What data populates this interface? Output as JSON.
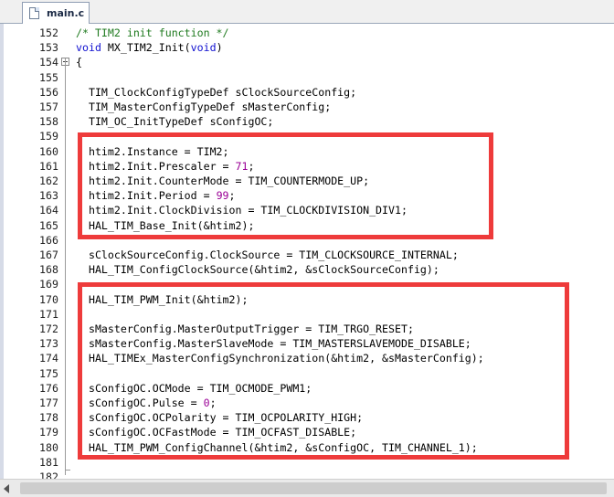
{
  "tab": {
    "label": "main.c",
    "icon": "c-file-icon"
  },
  "lines": [
    {
      "n": "152",
      "code": [
        {
          "t": "/* TIM2 init function */",
          "c": "comment"
        }
      ]
    },
    {
      "n": "153",
      "code": [
        {
          "t": "void",
          "c": "kw"
        },
        {
          "t": " MX_TIM2_Init("
        },
        {
          "t": "void",
          "c": "kw"
        },
        {
          "t": ")"
        }
      ]
    },
    {
      "n": "154",
      "code": [
        {
          "t": "{"
        }
      ],
      "fold": true
    },
    {
      "n": "155",
      "code": []
    },
    {
      "n": "156",
      "code": [
        {
          "t": "  TIM_ClockConfigTypeDef sClockSourceConfig;"
        }
      ]
    },
    {
      "n": "157",
      "code": [
        {
          "t": "  TIM_MasterConfigTypeDef sMasterConfig;"
        }
      ]
    },
    {
      "n": "158",
      "code": [
        {
          "t": "  TIM_OC_InitTypeDef sConfigOC;"
        }
      ]
    },
    {
      "n": "159",
      "code": []
    },
    {
      "n": "160",
      "code": [
        {
          "t": "  htim2.Instance = TIM2;"
        }
      ]
    },
    {
      "n": "161",
      "code": [
        {
          "t": "  htim2.Init.Prescaler = "
        },
        {
          "t": "71",
          "c": "num"
        },
        {
          "t": ";"
        }
      ]
    },
    {
      "n": "162",
      "code": [
        {
          "t": "  htim2.Init.CounterMode = TIM_COUNTERMODE_UP;"
        }
      ]
    },
    {
      "n": "163",
      "code": [
        {
          "t": "  htim2.Init.Period = "
        },
        {
          "t": "99",
          "c": "num"
        },
        {
          "t": ";"
        }
      ]
    },
    {
      "n": "164",
      "code": [
        {
          "t": "  htim2.Init.ClockDivision = TIM_CLOCKDIVISION_DIV1;"
        }
      ]
    },
    {
      "n": "165",
      "code": [
        {
          "t": "  HAL_TIM_Base_Init(&htim2);"
        }
      ]
    },
    {
      "n": "166",
      "code": []
    },
    {
      "n": "167",
      "code": [
        {
          "t": "  sClockSourceConfig.ClockSource = TIM_CLOCKSOURCE_INTERNAL;"
        }
      ]
    },
    {
      "n": "168",
      "code": [
        {
          "t": "  HAL_TIM_ConfigClockSource(&htim2, &sClockSourceConfig);"
        }
      ]
    },
    {
      "n": "169",
      "code": []
    },
    {
      "n": "170",
      "code": [
        {
          "t": "  HAL_TIM_PWM_Init(&htim2);"
        }
      ]
    },
    {
      "n": "171",
      "code": []
    },
    {
      "n": "172",
      "code": [
        {
          "t": "  sMasterConfig.MasterOutputTrigger = TIM_TRGO_RESET;"
        }
      ]
    },
    {
      "n": "173",
      "code": [
        {
          "t": "  sMasterConfig.MasterSlaveMode = TIM_MASTERSLAVEMODE_DISABLE;"
        }
      ]
    },
    {
      "n": "174",
      "code": [
        {
          "t": "  HAL_TIMEx_MasterConfigSynchronization(&htim2, &sMasterConfig);"
        }
      ]
    },
    {
      "n": "175",
      "code": []
    },
    {
      "n": "176",
      "code": [
        {
          "t": "  sConfigOC.OCMode = TIM_OCMODE_PWM1;"
        }
      ]
    },
    {
      "n": "177",
      "code": [
        {
          "t": "  sConfigOC.Pulse = "
        },
        {
          "t": "0",
          "c": "num"
        },
        {
          "t": ";"
        }
      ]
    },
    {
      "n": "178",
      "code": [
        {
          "t": "  sConfigOC.OCPolarity = TIM_OCPOLARITY_HIGH;"
        }
      ]
    },
    {
      "n": "179",
      "code": [
        {
          "t": "  sConfigOC.OCFastMode = TIM_OCFAST_DISABLE;"
        }
      ]
    },
    {
      "n": "180",
      "code": [
        {
          "t": "  HAL_TIM_PWM_ConfigChannel(&htim2, &sConfigOC, TIM_CHANNEL_1);"
        }
      ]
    },
    {
      "n": "181",
      "code": []
    },
    {
      "n": "182",
      "code": []
    },
    {
      "n": "",
      "code": [
        {
          "t": "}"
        }
      ]
    }
  ],
  "colors": {
    "comment": "#1f7a1f",
    "keyword": "#1010d0",
    "number": "#9a0096",
    "highlight": "#ee3b3b"
  }
}
